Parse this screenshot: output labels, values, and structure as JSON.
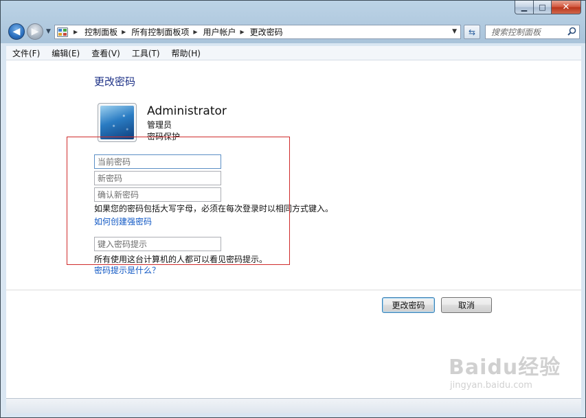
{
  "window": {
    "caption": {
      "minimize": "▁",
      "maximize": "□",
      "close": "✕"
    }
  },
  "nav": {
    "back_icon": "back-arrow-icon",
    "forward_icon": "forward-arrow-icon",
    "breadcrumb": [
      "控制面板",
      "所有控制面板项",
      "用户帐户",
      "更改密码"
    ],
    "search": {
      "placeholder": "搜索控制面板"
    }
  },
  "menu": [
    "文件(F)",
    "编辑(E)",
    "查看(V)",
    "工具(T)",
    "帮助(H)"
  ],
  "main": {
    "title": "更改密码",
    "user": {
      "name": "Administrator",
      "role": "管理员",
      "status": "密码保护"
    },
    "fields": {
      "current_placeholder": "当前密码",
      "new_placeholder": "新密码",
      "confirm_placeholder": "确认新密码",
      "hint_placeholder": "键入密码提示"
    },
    "caps_note": "如果您的密码包括大写字母，必须在每次登录时以相同方式键入。",
    "strong_link": "如何创建强密码",
    "hint_note": "所有使用这台计算机的人都可以看见密码提示。",
    "hint_link": "密码提示是什么？",
    "buttons": {
      "change": "更改密码",
      "cancel": "取消"
    }
  },
  "watermark": {
    "main": "Baidu经验",
    "sub": "jingyan.baidu.com"
  },
  "colors": {
    "title": "#1e3287",
    "link": "#0f57c4",
    "annotation": "#cf2a2a"
  }
}
